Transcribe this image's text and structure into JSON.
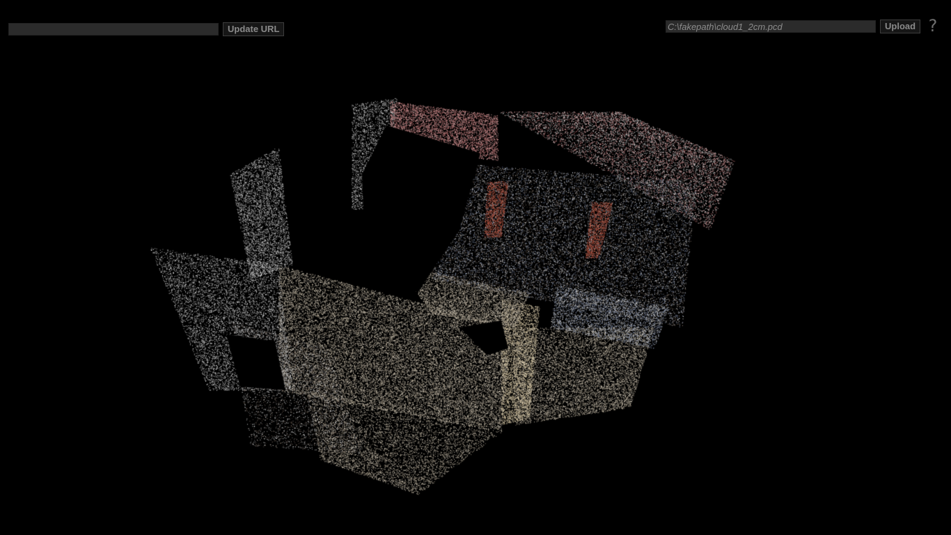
{
  "toolbar": {
    "url_value": "",
    "update_url_label": "Update URL"
  },
  "upload": {
    "file_value": "C:\\fakepath\\cloud1_2cm.pcd",
    "upload_label": "Upload"
  },
  "help": {
    "label": "?",
    "icon": "question-mark-icon"
  },
  "colors": {
    "background": "#000000",
    "control_bg": "#2b2b2b",
    "control_text": "#8a8a8a"
  }
}
